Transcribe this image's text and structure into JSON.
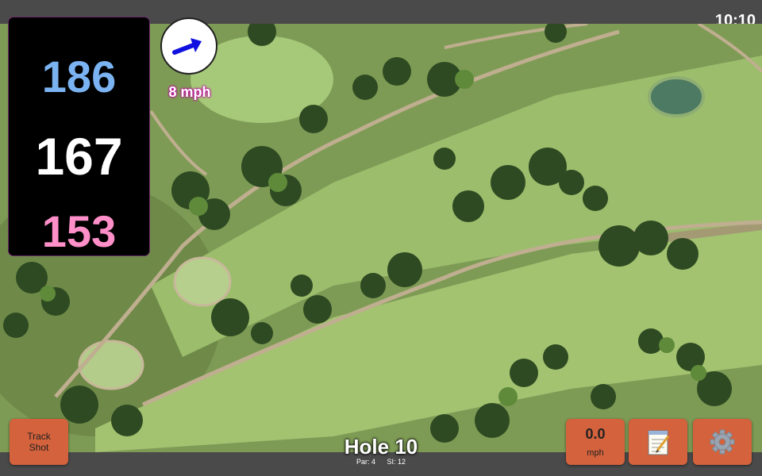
{
  "status_bar": {
    "time": "10:10"
  },
  "distances": {
    "back": "186",
    "middle": "167",
    "front": "153"
  },
  "wind": {
    "speed": "8 mph",
    "direction_icon": "arrow-icon"
  },
  "track_shot_button": {
    "label": "Track\nShot"
  },
  "speed_button": {
    "value": "0.0",
    "unit": "mph"
  },
  "notes_button": {
    "icon": "notepad-icon"
  },
  "settings_button": {
    "icon": "gear-icon"
  },
  "hole": {
    "title": "Hole 10",
    "par": "Par: 4",
    "si": "SI: 12"
  },
  "colors": {
    "back": "#7bb3f2",
    "middle": "#ffffff",
    "front": "#ff8fc8",
    "button": "#d4623c",
    "panel": "#000000"
  }
}
